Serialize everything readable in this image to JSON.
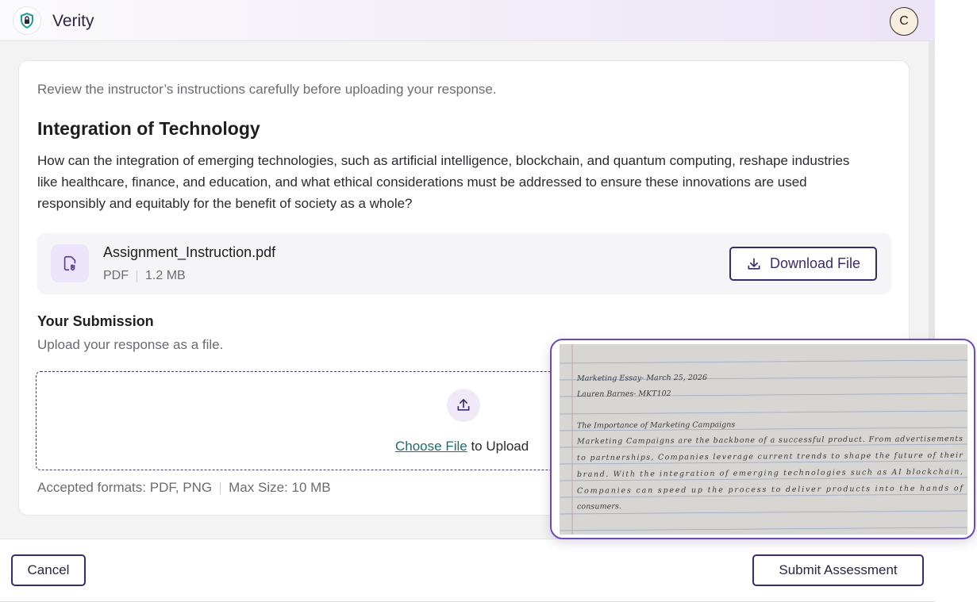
{
  "app": {
    "title": "Verity",
    "avatar_initial": "C"
  },
  "instructions": {
    "note": "Review the instructor’s instructions carefully before uploading your response.",
    "title": "Integration of Technology",
    "body": "How can the integration of emerging technologies, such as artificial intelligence, blockchain, and quantum computing, reshape industries like healthcare, finance, and education, and what ethical considerations must be addressed to ensure these innovations are used responsibly and equitably for the benefit of society as a whole?"
  },
  "attachment": {
    "name": "Assignment_Instruction.pdf",
    "type": "PDF",
    "size": "1.2 MB",
    "download_label": "Download File"
  },
  "submission": {
    "title": "Your Submission",
    "hint": "Upload your response as a file.",
    "choose_label": "Choose File",
    "upload_suffix": " to Upload",
    "formats": "Accepted formats: PDF, PNG",
    "max_size": "Max Size: 10 MB"
  },
  "footer": {
    "cancel_label": "Cancel",
    "submit_label": "Submit Assessment"
  },
  "preview_image": {
    "lines": [
      "Marketing Essay- March 25, 2026",
      "Lauren Barnes- MKT102",
      "The Importance of Marketing Campaigns",
      "Marketing Campaigns are the backbone of a successful product. From advertisements",
      "to partnerships, Companies leverage current trends to shape the future of their",
      "brand. With the integration of emerging technologies such as AI blockchain,",
      "Companies can speed up the process to deliver products into the hands of",
      "consumers."
    ]
  },
  "colors": {
    "accent": "#3c2a6e",
    "link": "#1e6b6e",
    "preview_border": "#6a4bb7"
  },
  "icons": {
    "logo": "shield-lock-icon",
    "file": "file-attachment-icon",
    "download": "download-icon",
    "upload": "upload-icon"
  }
}
